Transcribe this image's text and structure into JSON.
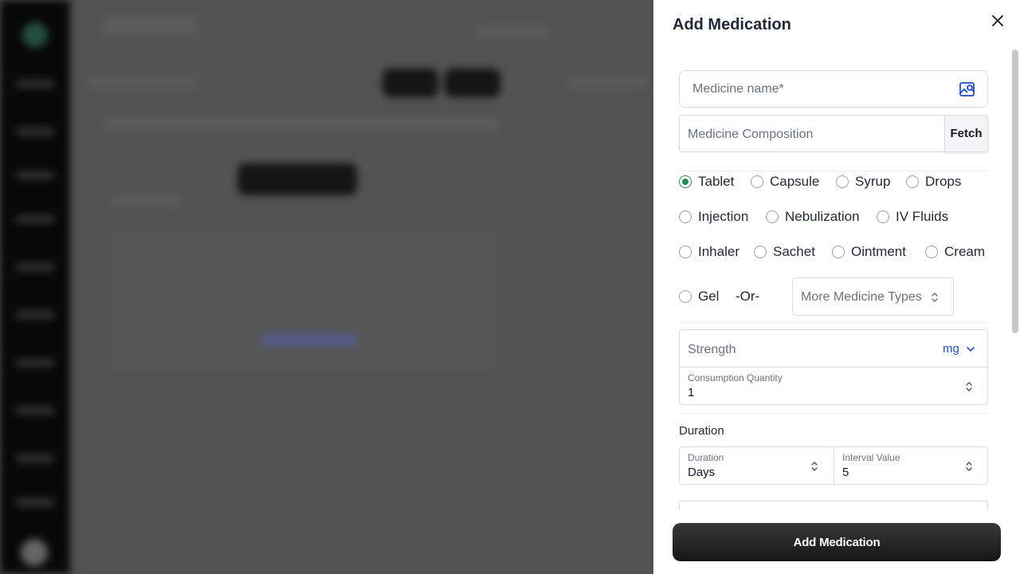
{
  "panel": {
    "title": "Add Medication",
    "medicine_name_placeholder": "Medicine name*",
    "composition_placeholder": "Medicine Composition",
    "fetch_label": "Fetch",
    "medicine_types": [
      {
        "label": "Tablet",
        "checked": true
      },
      {
        "label": "Capsule",
        "checked": false
      },
      {
        "label": "Syrup",
        "checked": false
      },
      {
        "label": "Drops",
        "checked": false
      },
      {
        "label": "Injection",
        "checked": false
      },
      {
        "label": "Nebulization",
        "checked": false
      },
      {
        "label": "IV Fluids",
        "checked": false
      },
      {
        "label": "Inhaler",
        "checked": false
      },
      {
        "label": "Sachet",
        "checked": false
      },
      {
        "label": "Ointment",
        "checked": false
      },
      {
        "label": "Cream",
        "checked": false
      },
      {
        "label": "Gel",
        "checked": false
      }
    ],
    "or_text": "-Or-",
    "more_types_placeholder": "More Medicine Types",
    "strength_placeholder": "Strength",
    "strength_unit": "mg",
    "consumption_label": "Consumption Quantity",
    "consumption_value": "1",
    "duration_section": "Duration",
    "duration_label": "Duration",
    "duration_value": "Days",
    "interval_label": "Interval Value",
    "interval_value": "5",
    "submit_label": "Add Medication"
  },
  "colors": {
    "accent_green": "#2e8b57",
    "unit_blue": "#1d4ed8",
    "button_dark": "#1c1c1c"
  },
  "icons": {
    "close": "close-icon",
    "image_search": "image-search-icon",
    "updown": "chevron-updown-icon",
    "dropdown": "chevron-down-icon"
  }
}
